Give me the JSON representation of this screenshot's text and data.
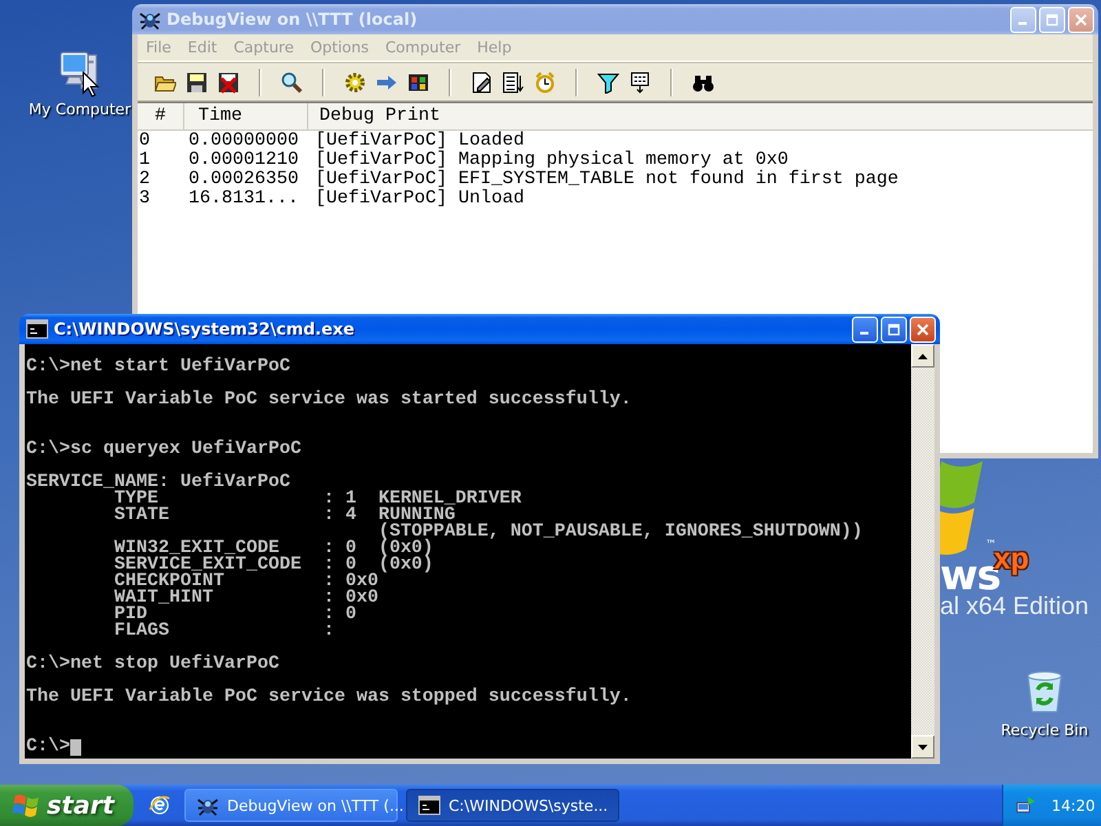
{
  "desktop": {
    "icons": [
      {
        "kind": "computer",
        "label": "My Computer"
      },
      {
        "kind": "recycle-bin",
        "label": "Recycle Bin"
      }
    ],
    "logo": {
      "wordmark": "ws",
      "trademark": "™",
      "xp": "xp",
      "edition": "al x64 Edition"
    }
  },
  "debugview": {
    "title": "DebugView on \\\\TTT (local)",
    "active": false,
    "menu": [
      "File",
      "Edit",
      "Capture",
      "Options",
      "Computer",
      "Help"
    ],
    "columns": [
      "#",
      "Time",
      "Debug Print"
    ],
    "rows": [
      {
        "index": "0",
        "time": "0.00000000",
        "text": "[UefiVarPoC] Loaded"
      },
      {
        "index": "1",
        "time": "0.00001210",
        "text": "[UefiVarPoC] Mapping physical memory at 0x0"
      },
      {
        "index": "2",
        "time": "0.00026350",
        "text": "[UefiVarPoC] EFI_SYSTEM_TABLE not found in first page"
      },
      {
        "index": "3",
        "time": "16.8131...",
        "text": "[UefiVarPoC] Unload"
      }
    ]
  },
  "cmd": {
    "title": "C:\\WINDOWS\\system32\\cmd.exe",
    "active": true,
    "lines": [
      {
        "kind": "text",
        "text": "C:\\>net start UefiVarPoC"
      },
      {
        "kind": "blank"
      },
      {
        "kind": "text",
        "text": "The UEFI Variable PoC service was started successfully."
      },
      {
        "kind": "blank"
      },
      {
        "kind": "blank"
      },
      {
        "kind": "text",
        "text": "C:\\>sc queryex UefiVarPoC"
      },
      {
        "kind": "blank"
      },
      {
        "kind": "text",
        "text": "SERVICE_NAME: UefiVarPoC"
      },
      {
        "kind": "text",
        "text": "        TYPE               : 1  KERNEL_DRIVER"
      },
      {
        "kind": "text",
        "text": "        STATE              : 4  RUNNING"
      },
      {
        "kind": "text",
        "text": "                                (STOPPABLE, NOT_PAUSABLE, IGNORES_SHUTDOWN))"
      },
      {
        "kind": "text",
        "text": "        WIN32_EXIT_CODE    : 0  (0x0)"
      },
      {
        "kind": "text",
        "text": "        SERVICE_EXIT_CODE  : 0  (0x0)"
      },
      {
        "kind": "text",
        "text": "        CHECKPOINT         : 0x0"
      },
      {
        "kind": "text",
        "text": "        WAIT_HINT          : 0x0"
      },
      {
        "kind": "text",
        "text": "        PID                : 0"
      },
      {
        "kind": "text",
        "text": "        FLAGS              :"
      },
      {
        "kind": "blank"
      },
      {
        "kind": "text",
        "text": "C:\\>net stop UefiVarPoC"
      },
      {
        "kind": "blank"
      },
      {
        "kind": "text",
        "text": "The UEFI Variable PoC service was stopped successfully."
      },
      {
        "kind": "blank"
      },
      {
        "kind": "blank"
      },
      {
        "kind": "prompt",
        "text": "C:\\>"
      }
    ]
  },
  "taskbar": {
    "start": "start",
    "tasks": [
      {
        "kind": "debugview",
        "label": "DebugView on \\\\TTT (...",
        "selected": false
      },
      {
        "kind": "console",
        "label": "C:\\WINDOWS\\syste...",
        "selected": true
      }
    ],
    "clock": "14:20"
  }
}
